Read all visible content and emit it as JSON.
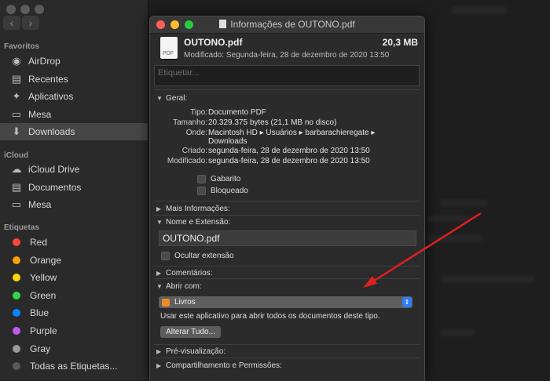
{
  "finder": {
    "sections": {
      "favoritos": "Favoritos",
      "icloud": "iCloud",
      "etiquetas": "Etiquetas"
    },
    "favorites": [
      {
        "label": "AirDrop",
        "icon": "airdrop-icon"
      },
      {
        "label": "Recentes",
        "icon": "recents-icon"
      },
      {
        "label": "Aplicativos",
        "icon": "applications-icon"
      },
      {
        "label": "Mesa",
        "icon": "desktop-icon"
      },
      {
        "label": "Downloads",
        "icon": "downloads-icon",
        "selected": true
      }
    ],
    "icloud": [
      {
        "label": "iCloud Drive",
        "icon": "cloud-icon"
      },
      {
        "label": "Documentos",
        "icon": "documents-icon"
      },
      {
        "label": "Mesa",
        "icon": "desktop-icon"
      }
    ],
    "tags": [
      {
        "label": "Red",
        "color": "#ff453a"
      },
      {
        "label": "Orange",
        "color": "#ff9f0a"
      },
      {
        "label": "Yellow",
        "color": "#ffd60a"
      },
      {
        "label": "Green",
        "color": "#32d74b"
      },
      {
        "label": "Blue",
        "color": "#0a84ff"
      },
      {
        "label": "Purple",
        "color": "#bf5af2"
      },
      {
        "label": "Gray",
        "color": "#98989d"
      },
      {
        "label": "Todas as Etiquetas...",
        "color": "#5a5a5a"
      }
    ]
  },
  "info": {
    "window_title": "Informações de OUTONO.pdf",
    "file_name": "OUTONO.pdf",
    "file_size": "20,3 MB",
    "modified_line": "Modificado: Segunda-feira, 28 de dezembro de 2020 13:50",
    "file_icon_label": "PDF",
    "tag_placeholder": "Etiquetar...",
    "general": {
      "header": "Geral:",
      "rows": [
        {
          "label": "Tipo:",
          "value": "Documento PDF"
        },
        {
          "label": "Tamanho:",
          "value": "20.329.375 bytes (21,1 MB no disco)"
        },
        {
          "label": "Onde:",
          "value": "Macintosh HD ▸ Usuários ▸ barbarachieregate ▸ Downloads"
        },
        {
          "label": "Criado:",
          "value": "segunda-feira, 28 de dezembro de 2020 13:50"
        },
        {
          "label": "Modificado:",
          "value": "segunda-feira, 28 de dezembro de 2020 13:50"
        }
      ],
      "stationery": "Gabarito",
      "locked": "Bloqueado"
    },
    "more_info": "Mais Informações:",
    "name_ext": {
      "header": "Nome e Extensão:",
      "value": "OUTONO.pdf",
      "hide_ext": "Ocultar extensão"
    },
    "comments": "Comentários:",
    "open_with": {
      "header": "Abrir com:",
      "app": "Livros",
      "note": "Usar este aplicativo para abrir todos os documentos deste tipo.",
      "change_all": "Alterar Tudo..."
    },
    "preview": "Pré-visualização:",
    "sharing": "Compartilhamento e Permissões:"
  },
  "colors": {
    "arrow": "#e02020",
    "selected_row": "#464646",
    "select_accent": "#2f7ef5"
  }
}
